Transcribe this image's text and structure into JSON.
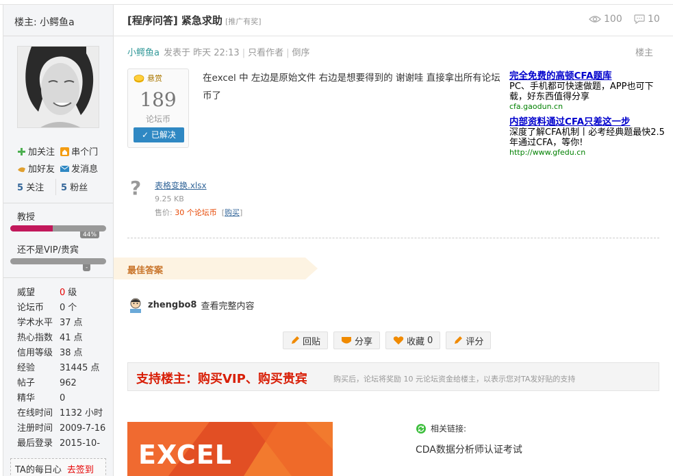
{
  "header": {
    "op_label": "楼主: 小鳄鱼a",
    "thread_title": "[程序问答] 紧急求助",
    "title_tag": "[推广有奖]",
    "views": "100",
    "replies": "10"
  },
  "user": {
    "follow_label": "加关注",
    "message_label": "串个门",
    "friend_label": "加好友",
    "pm_label": "发消息",
    "following_count": "5",
    "following_label": "关注",
    "fans_count": "5",
    "fans_label": "粉丝",
    "rank": "教授",
    "rank_percent": 44,
    "rank_percent_label": "44%",
    "vip_label": "还不是VIP/贵宾",
    "vip_badge": "-",
    "stats": [
      {
        "k": "威望",
        "v": "0",
        "unit": "级",
        "red": true
      },
      {
        "k": "论坛币",
        "v": "0",
        "unit": "个"
      },
      {
        "k": "学术水平",
        "v": "37",
        "unit": "点"
      },
      {
        "k": "热心指数",
        "v": "41",
        "unit": "点"
      },
      {
        "k": "信用等级",
        "v": "38",
        "unit": "点"
      },
      {
        "k": "经验",
        "v": "31445",
        "unit": "点"
      },
      {
        "k": "帖子",
        "v": "962",
        "unit": ""
      },
      {
        "k": "精华",
        "v": "0",
        "unit": ""
      },
      {
        "k": "在线时间",
        "v": "1132",
        "unit": "小时"
      },
      {
        "k": "注册时间",
        "v": "2009-7-16",
        "unit": ""
      },
      {
        "k": "最后登录",
        "v": "2015-10-",
        "unit": ""
      }
    ],
    "checkin_text": "TA的每日心",
    "checkin_link": "去签到"
  },
  "post": {
    "author": "小鳄鱼a",
    "posted_at": "发表于 昨天 22:13",
    "only_author": "只看作者",
    "reverse": "倒序",
    "floor": "楼主",
    "reward_title": "悬赏",
    "reward_amount": "189",
    "reward_unit": "论坛币",
    "solved_label": "已解决",
    "body": "在excel 中   左边是原始文件    右边是想要得到的    谢谢哇  直接拿出所有论坛币了"
  },
  "ads": [
    {
      "title": "完全免费的高顿CFA题库",
      "desc": "PC、手机都可快速做题，APP也可下载，好东西值得分享",
      "url": "cfa.gaodun.cn"
    },
    {
      "title": "内部资料通过CFA只差这一步",
      "desc": "深度了解CFA机制丨必考经典题最快2.5年通过CFA，等你!",
      "url": "http://www.gfedu.cn"
    }
  ],
  "attachment": {
    "filename": "表格变换.xlsx",
    "size": "9.25 KB",
    "price_prefix": "售价: ",
    "price_amount": "30 个论坛币",
    "buy": "购买"
  },
  "best_answer": {
    "banner": "最佳答案",
    "username": "zhengbo8",
    "view_full": "查看完整内容"
  },
  "actions": {
    "reply": "回贴",
    "share": "分享",
    "favorite": "收藏",
    "favorite_count": "0",
    "rate": "评分"
  },
  "support": {
    "headline": "支持楼主：购买VIP、购买贵宾",
    "note": "购买后，论坛将奖励 10 元论坛资金给楼主，以表示您对TA发好贴的支持"
  },
  "banner": {
    "word": "EXCEL"
  },
  "related": {
    "label": "相关链接:",
    "link": "CDA数据分析师认证考试"
  },
  "colors": {
    "accent_teal": "#339999",
    "link_blue": "#336699",
    "alert_red": "#d81e06",
    "solved_blue": "#2f88c3",
    "rank_bar": "#c2185b",
    "excel_orange": "#e8552a"
  }
}
